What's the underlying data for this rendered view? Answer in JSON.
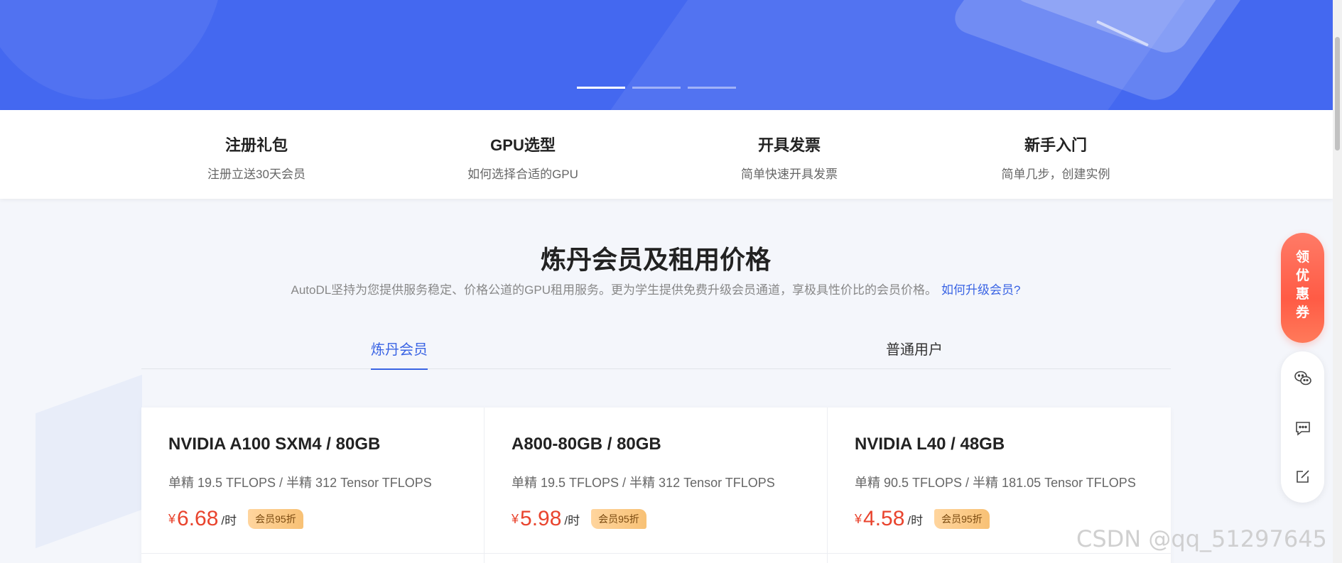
{
  "banner": {
    "carousel_count": 3,
    "active_index": 0
  },
  "quicklinks": [
    {
      "title": "注册礼包",
      "subtitle": "注册立送30天会员"
    },
    {
      "title": "GPU选型",
      "subtitle": "如何选择合适的GPU"
    },
    {
      "title": "开具发票",
      "subtitle": "简单快速开具发票"
    },
    {
      "title": "新手入门",
      "subtitle": "简单几步，创建实例"
    }
  ],
  "pricing": {
    "title": "炼丹会员及租用价格",
    "description": "AutoDL坚持为您提供服务稳定、价格公道的GPU租用服务。更为学生提供免费升级会员通道，享极具性价比的会员价格。",
    "upgrade_link": "如何升级会员?",
    "tabs": [
      {
        "label": "炼丹会员",
        "active": true
      },
      {
        "label": "普通用户",
        "active": false
      }
    ],
    "cards": [
      {
        "name": "NVIDIA A100 SXM4 / 80GB",
        "spec": "单精 19.5 TFLOPS / 半精 312 Tensor TFLOPS",
        "currency": "¥",
        "price": "6.68",
        "unit": "/时",
        "badge": "会员95折"
      },
      {
        "name": "A800-80GB / 80GB",
        "spec": "单精 19.5 TFLOPS / 半精 312 Tensor TFLOPS",
        "currency": "¥",
        "price": "5.98",
        "unit": "/时",
        "badge": "会员95折"
      },
      {
        "name": "NVIDIA L40 / 48GB",
        "spec": "单精 90.5 TFLOPS / 半精 181.05 Tensor TFLOPS",
        "currency": "¥",
        "price": "4.58",
        "unit": "/时",
        "badge": "会员95折"
      }
    ]
  },
  "float_panel": {
    "coupon_chars": [
      "领",
      "优",
      "惠",
      "券"
    ],
    "tools": [
      "wechat-icon",
      "message-icon",
      "edit-icon"
    ]
  },
  "watermark": "CSDN @qq_51297645",
  "colors": {
    "primary": "#3a64e4",
    "banner": "#4468f0",
    "price": "#e9442e",
    "coupon": "#ff5b45"
  }
}
